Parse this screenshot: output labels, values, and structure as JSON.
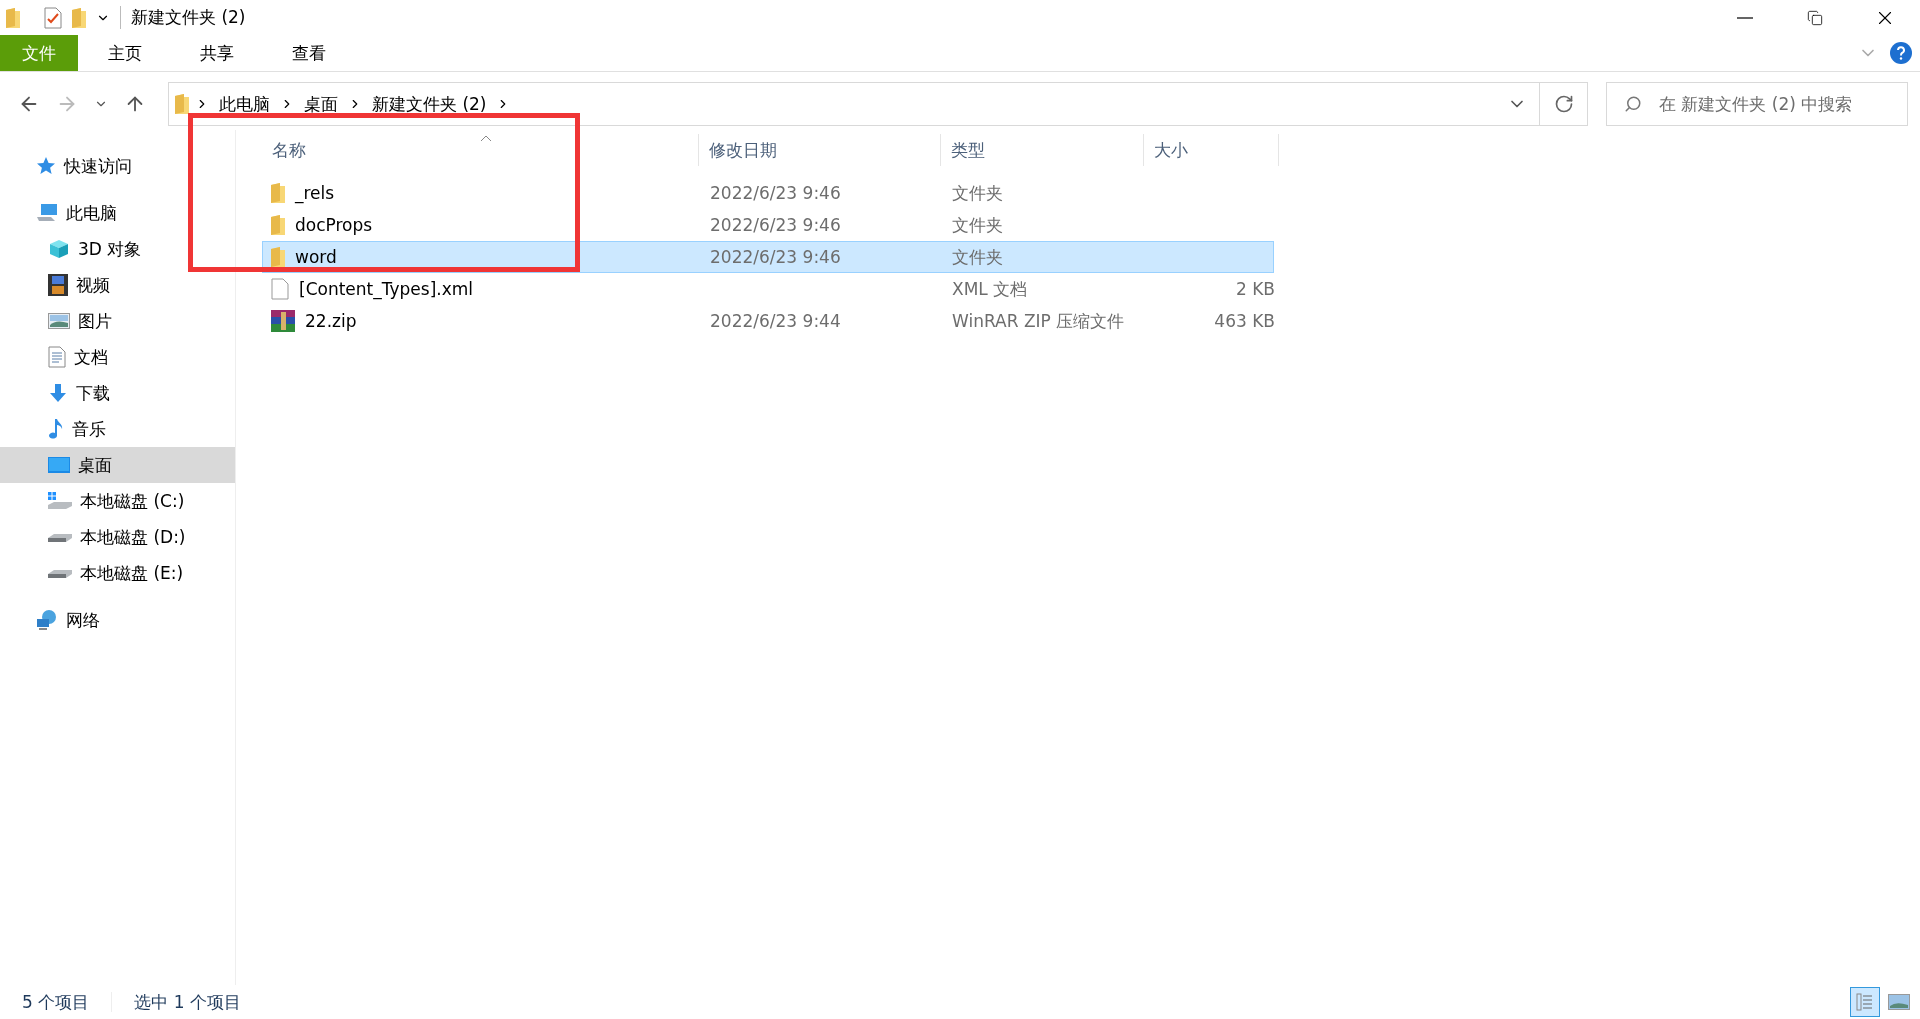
{
  "window": {
    "title": "新建文件夹 (2)"
  },
  "ribbon_tabs": [
    {
      "label": "文件",
      "kind": "file"
    },
    {
      "label": "主页",
      "kind": "tab"
    },
    {
      "label": "共享",
      "kind": "tab"
    },
    {
      "label": "查看",
      "kind": "tab"
    }
  ],
  "address_bar": {
    "path": [
      "此电脑",
      "桌面",
      "新建文件夹 (2)"
    ]
  },
  "search": {
    "placeholder": "在 新建文件夹 (2) 中搜索"
  },
  "sidebar": {
    "items": [
      {
        "label": "快速访问",
        "kind": "star",
        "selected": false
      },
      {
        "label": "此电脑",
        "kind": "pc",
        "selected": false,
        "children": [
          {
            "label": "3D 对象",
            "kind": "cube",
            "selected": false
          },
          {
            "label": "视频",
            "kind": "film",
            "selected": false
          },
          {
            "label": "图片",
            "kind": "image",
            "selected": false
          },
          {
            "label": "文档",
            "kind": "document",
            "selected": false
          },
          {
            "label": "下载",
            "kind": "download",
            "selected": false
          },
          {
            "label": "音乐",
            "kind": "music",
            "selected": false
          },
          {
            "label": "桌面",
            "kind": "desktop",
            "selected": true
          },
          {
            "label": "本地磁盘 (C:)",
            "kind": "system-drive",
            "selected": false
          },
          {
            "label": "本地磁盘 (D:)",
            "kind": "drive",
            "selected": false
          },
          {
            "label": "本地磁盘 (E:)",
            "kind": "drive",
            "selected": false
          }
        ]
      },
      {
        "label": "网络",
        "kind": "network",
        "selected": false
      }
    ]
  },
  "table": {
    "columns": [
      {
        "label": "名称",
        "sorted": true
      },
      {
        "label": "修改日期",
        "sorted": false
      },
      {
        "label": "类型",
        "sorted": false
      },
      {
        "label": "大小",
        "sorted": false
      }
    ],
    "rows": [
      {
        "name": "_rels",
        "modified": "2022/6/23 9:46",
        "type": "文件夹",
        "kind": "folder",
        "selected": false
      },
      {
        "name": "docProps",
        "modified": "2022/6/23 9:46",
        "type": "文件夹",
        "kind": "folder",
        "selected": false
      },
      {
        "name": "word",
        "modified": "2022/6/23 9:46",
        "type": "文件夹",
        "kind": "folder",
        "selected": true
      },
      {
        "name": "[Content_Types].xml",
        "type": "XML 文档",
        "size": "2 KB",
        "kind": "file",
        "selected": false
      },
      {
        "name": "22.zip",
        "modified": "2022/6/23 9:44",
        "type": "WinRAR ZIP 压缩文件",
        "size": "463 KB",
        "kind": "archive",
        "selected": false
      }
    ]
  },
  "status_bar": {
    "item_count": "5 个项目",
    "selection": "选中 1 个项目"
  },
  "view_buttons": [
    {
      "kind": "details",
      "selected": true
    },
    {
      "kind": "large-icons",
      "selected": false
    }
  ],
  "annotation": {
    "kind": "highlight-box"
  }
}
